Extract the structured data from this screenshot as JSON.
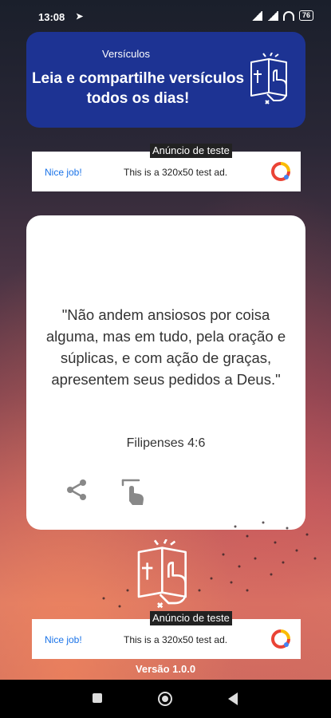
{
  "status_bar": {
    "time": "13:08",
    "battery": "76"
  },
  "header": {
    "subtitle": "Versículos",
    "title": "Leia e compartilhe versículos todos os dias!"
  },
  "ads": [
    {
      "label": "Anúncio de teste",
      "nice": "Nice job!",
      "text": "This is a 320x50 test ad."
    },
    {
      "label": "Anúncio de teste",
      "nice": "Nice job!",
      "text": "This is a 320x50 test ad."
    }
  ],
  "verse": {
    "text": "\"Não andem ansiosos por coisa alguma, mas em tudo, pela oração e súplicas, e com ação de graças, apresentem seus pedidos a Deus.\"",
    "reference": "Filipenses 4:6"
  },
  "version": "Versão 1.0.0",
  "colors": {
    "header_bg": "#1d3393",
    "accent_blue": "#1a73e8",
    "card_bg": "#ffffff"
  },
  "icons": [
    "share-icon",
    "touch-icon",
    "bible-icon",
    "ad-logo-icon"
  ]
}
